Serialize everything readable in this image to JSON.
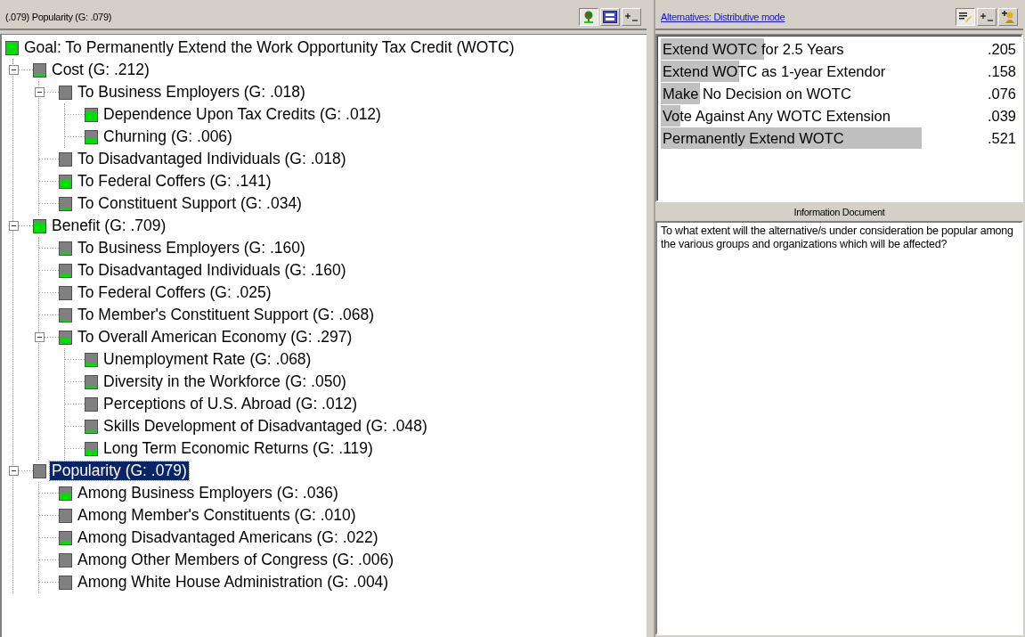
{
  "left_header": {
    "title": "(.079) Popularity (G: .079)",
    "tools": [
      {
        "kind": "tree",
        "selected": true
      },
      {
        "kind": "panel",
        "selected": false
      },
      {
        "kind": "plusminus",
        "selected": false
      }
    ]
  },
  "tree": [
    {
      "label": "Goal: To Permanently Extend the Work Opportunity Tax Credit (WOTC)",
      "level": 1,
      "selected": false,
      "children": [
        {
          "label": "Cost (G: .212)",
          "level": 0.2,
          "selected": false,
          "expanded": true,
          "children": [
            {
              "label": "To Business Employers (G: .018)",
              "level": 0.05,
              "selected": false,
              "expanded": true,
              "children": [
                {
                  "label": "Dependence Upon Tax Credits (G: .012)",
                  "level": 0.65,
                  "selected": false
                },
                {
                  "label": "Churning (G: .006)",
                  "level": 0.35,
                  "selected": false
                }
              ]
            },
            {
              "label": "To Disadvantaged Individuals (G: .018)",
              "level": 0.05,
              "selected": false
            },
            {
              "label": "To Federal Coffers (G: .141)",
              "level": 0.65,
              "selected": false
            },
            {
              "label": "To Constituent Support (G: .034)",
              "level": 0.15,
              "selected": false
            }
          ]
        },
        {
          "label": "Benefit (G: .709)",
          "level": 0.7,
          "selected": false,
          "expanded": true,
          "children": [
            {
              "label": "To Business Employers (G: .160)",
              "level": 0.22,
              "selected": false
            },
            {
              "label": "To Disadvantaged Individuals (G: .160)",
              "level": 0.22,
              "selected": false
            },
            {
              "label": "To Federal Coffers (G: .025)",
              "level": 0.04,
              "selected": false
            },
            {
              "label": "To Member's Constituent Support (G: .068)",
              "level": 0.1,
              "selected": false
            },
            {
              "label": "To Overall American Economy (G: .297)",
              "level": 0.42,
              "selected": false,
              "expanded": true,
              "children": [
                {
                  "label": "Unemployment Rate (G: .068)",
                  "level": 0.23,
                  "selected": false
                },
                {
                  "label": "Diversity in the Workforce (G: .050)",
                  "level": 0.17,
                  "selected": false
                },
                {
                  "label": "Perceptions of U.S. Abroad (G: .012)",
                  "level": 0.04,
                  "selected": false
                },
                {
                  "label": "Skills Development of Disadvantaged (G: .048)",
                  "level": 0.16,
                  "selected": false
                },
                {
                  "label": "Long Term Economic Returns (G: .119)",
                  "level": 0.4,
                  "selected": false
                }
              ]
            }
          ]
        },
        {
          "label": "Popularity (G: .079)",
          "level": 0.08,
          "selected": true,
          "expanded": true,
          "children": [
            {
              "label": "Among Business Employers (G: .036)",
              "level": 0.45,
              "selected": false
            },
            {
              "label": "Among Member's Constituents (G: .010)",
              "level": 0.12,
              "selected": false
            },
            {
              "label": "Among Disadvantaged Americans (G: .022)",
              "level": 0.28,
              "selected": false
            },
            {
              "label": "Among Other Members of Congress (G: .006)",
              "level": 0.08,
              "selected": false
            },
            {
              "label": "Among White House Administration (G: .004)",
              "level": 0.05,
              "selected": false
            }
          ]
        }
      ]
    }
  ],
  "right_header": {
    "link": "Alternatives: Distributive mode",
    "tools": [
      {
        "kind": "edit",
        "selected": true
      },
      {
        "kind": "plusminus",
        "selected": false
      },
      {
        "kind": "add",
        "selected": false
      }
    ]
  },
  "alternatives": [
    {
      "name": "Extend WOTC for 2.5 Years",
      "value": ".205",
      "level": 0.29
    },
    {
      "name": "Extend WOTC as 1-year Extendor",
      "value": ".158",
      "level": 0.22
    },
    {
      "name": "Make No Decision on WOTC",
      "value": ".076",
      "level": 0.11
    },
    {
      "name": "Vote Against Any WOTC Extension",
      "value": ".039",
      "level": 0.055
    },
    {
      "name": "Permanently Extend WOTC",
      "value": ".521",
      "level": 0.735
    }
  ],
  "information_document": {
    "title": "Information Document",
    "text": "To what extent will the alternative/s under consideration be popular among the various groups and organizations which will be affected?"
  }
}
